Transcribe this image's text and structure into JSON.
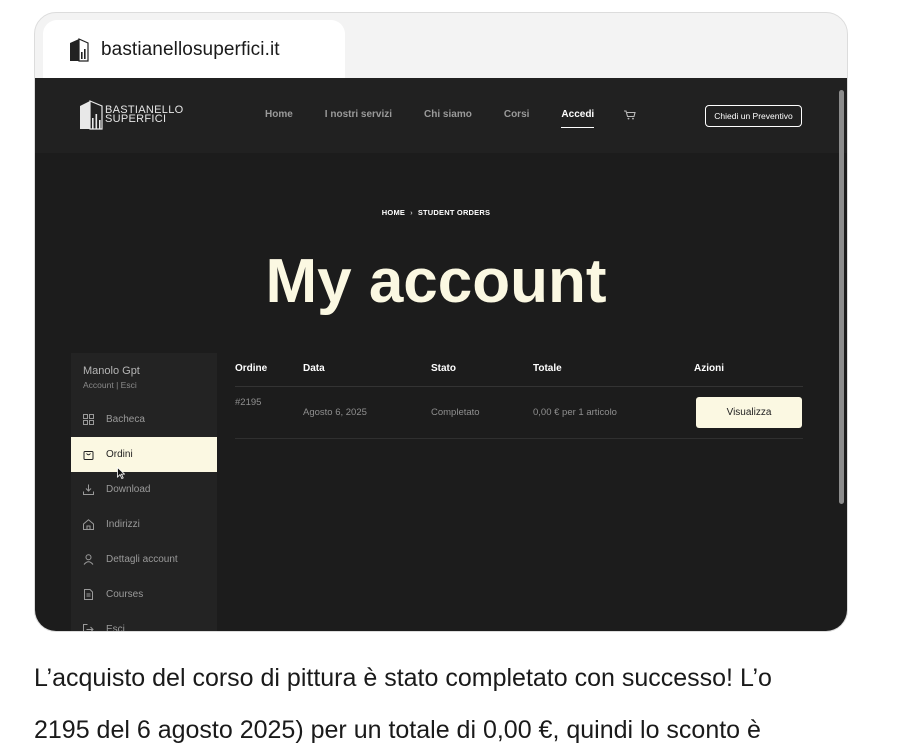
{
  "browser": {
    "tab_title": "bastianellosuperfici.it",
    "icon": "site-favicon-icon"
  },
  "site": {
    "logo_line1": "BASTIANELLO",
    "logo_line2": "SUPERFICI",
    "nav": [
      "Home",
      "I nostri servizi",
      "Chi siamo",
      "Corsi",
      "Accedi"
    ],
    "nav_active": "Accedi",
    "cart_icon": "cart-icon",
    "quote_button": "Chiedi un Preventivo"
  },
  "breadcrumb": {
    "home": "HOME",
    "separator": "›",
    "current": "STUDENT ORDERS"
  },
  "page_title": "My account",
  "sidebar": {
    "user_name": "Manolo Gpt",
    "user_links": "Account | Esci",
    "items": [
      {
        "label": "Bacheca",
        "icon": "dashboard-icon"
      },
      {
        "label": "Ordini",
        "icon": "orders-bag-icon",
        "active": true
      },
      {
        "label": "Download",
        "icon": "download-icon"
      },
      {
        "label": "Indirizzi",
        "icon": "home-icon"
      },
      {
        "label": "Dettagli account",
        "icon": "user-icon"
      },
      {
        "label": "Courses",
        "icon": "document-icon"
      },
      {
        "label": "Esci",
        "icon": "logout-icon"
      }
    ]
  },
  "orders": {
    "headers": {
      "order": "Ordine",
      "date": "Data",
      "status": "Stato",
      "total": "Totale",
      "actions": "Azioni"
    },
    "rows": [
      {
        "order": "#2195",
        "date": "Agosto 6, 2025",
        "status": "Completato",
        "total": "0,00 € per 1 articolo",
        "action": "Visualizza"
      }
    ]
  },
  "message": {
    "line1": "L’acquisto del corso di pittura è stato completato con successo! L’o",
    "line2": "2195 del 6 agosto 2025) per un totale di 0,00 €, quindi lo sconto è"
  },
  "colors": {
    "page_bg": "#1c1c1c",
    "header_bg": "#212121",
    "accent_cream": "#fbf8e2"
  }
}
